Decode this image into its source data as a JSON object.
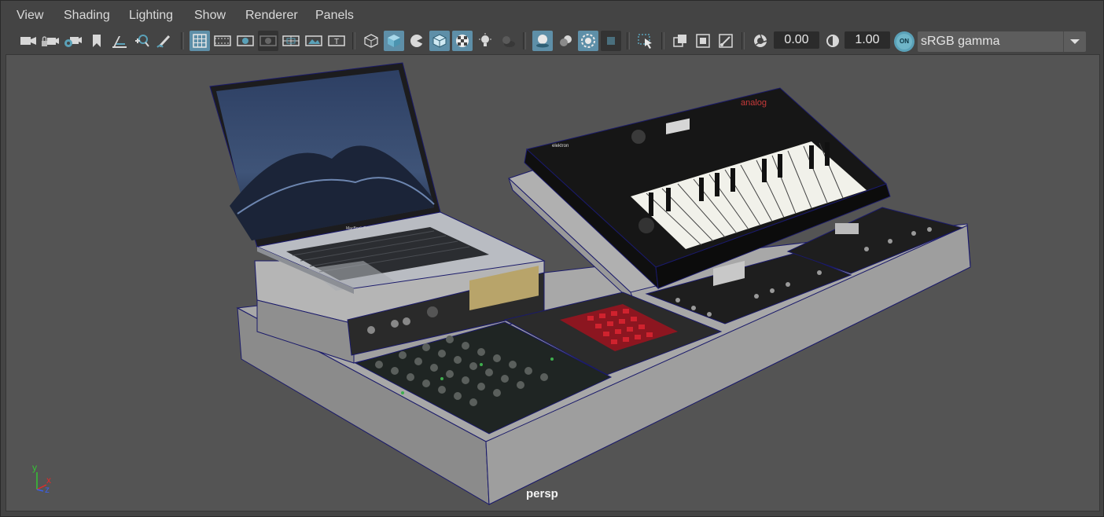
{
  "menubar": {
    "items": [
      "View",
      "Shading",
      "Lighting",
      "Show",
      "Renderer",
      "Panels"
    ]
  },
  "toolbar": {
    "exposure_value": "0.00",
    "gamma_value": "1.00",
    "color_mgmt_badge": "ON",
    "color_space": "sRGB gamma",
    "icons": [
      "camera",
      "camera-lock",
      "camera-attributes",
      "bookmark",
      "image-plane",
      "grease-pencil",
      "two-d-pan-zoom",
      "grid",
      "film-gate",
      "resolution-gate",
      "gate-mask",
      "field-chart",
      "safe-action",
      "safe-title",
      "wireframe",
      "smooth-shade",
      "wireframe-on-shaded",
      "default-material",
      "textured",
      "use-lights",
      "shadows",
      "screen-space-ambient-occlusion",
      "motion-blur",
      "anti-aliasing",
      "depth-of-field",
      "isolate-select",
      "x-ray",
      "x-ray-active-components",
      "x-ray-joints",
      "exposure",
      "gamma",
      "color-management",
      "dropdown"
    ]
  },
  "viewport": {
    "camera_label": "persp",
    "axis": {
      "x": "x",
      "y": "y",
      "z": "z"
    },
    "laptop_label": "MacBook Pro",
    "synth_brand": "elektron",
    "synth_logo": "analog"
  }
}
